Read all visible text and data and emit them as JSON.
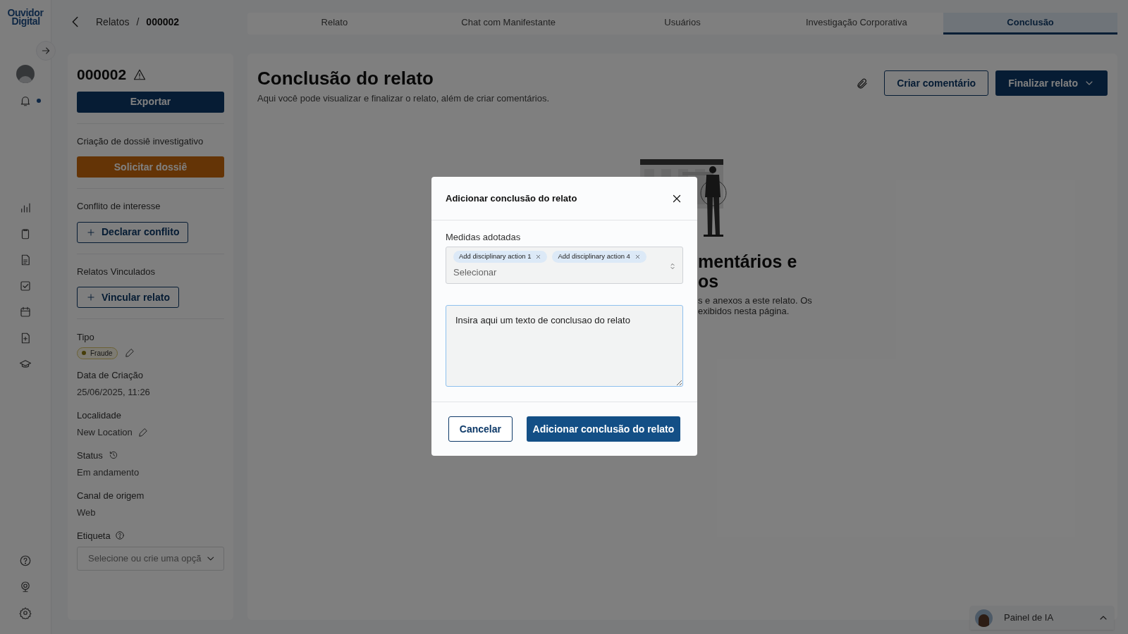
{
  "logo": {
    "lines": [
      "Ouvidor",
      "Digital"
    ]
  },
  "breadcrumb": {
    "parent": "Relatos",
    "separator": "/",
    "current": "000002"
  },
  "tabs": [
    {
      "label": "Relato",
      "selected": false
    },
    {
      "label": "Chat com Manifestante",
      "selected": false
    },
    {
      "label": "Usuários",
      "selected": false
    },
    {
      "label": "Investigação Corporativa",
      "selected": false
    },
    {
      "label": "Conclusão",
      "selected": true
    }
  ],
  "sidebar": {
    "id": "000002",
    "export_button": "Exportar",
    "dossier": {
      "label": "Criação de dossiê investigativo",
      "button": "Solicitar dossiê"
    },
    "conflict": {
      "label": "Conflito de interesse",
      "button": "Declarar conflito"
    },
    "linked": {
      "label": "Relatos Vinculados",
      "button": "Vincular relato"
    },
    "tipo": {
      "label": "Tipo",
      "badge": "Fraude"
    },
    "created": {
      "label": "Data de Criação",
      "value": "25/06/2025, 11:26"
    },
    "location": {
      "label": "Localidade",
      "value": "New Location"
    },
    "status": {
      "label": "Status",
      "value": "Em andamento"
    },
    "channel": {
      "label": "Canal de origem",
      "value": "Web"
    },
    "tag": {
      "label": "Etiqueta",
      "placeholder": "Selecione ou crie uma opçã"
    }
  },
  "main": {
    "title": "Conclusão do relato",
    "subtitle": "Aqui você pode visualizar e finalizar o relato, além de criar comentários.",
    "comment_button": "Criar comentário",
    "finalize_button": "Finalizar relato",
    "empty_state": {
      "title_lines": [
        "mentários e",
        "os"
      ],
      "text_lines": [
        "s e anexos a este relato. Os",
        "exibidos nesta página."
      ]
    }
  },
  "modal": {
    "title": "Adicionar conclusão do relato",
    "field_label": "Medidas adotadas",
    "chips": [
      "Add disciplinary action 1",
      "Add disciplinary action 4"
    ],
    "select_placeholder": "Selecionar",
    "textarea_value": "Insira aqui um texto de conclusao do relato",
    "cancel_button": "Cancelar",
    "submit_button": "Adicionar conclusão do relato"
  },
  "ai_panel": {
    "label": "Painel de IA"
  }
}
